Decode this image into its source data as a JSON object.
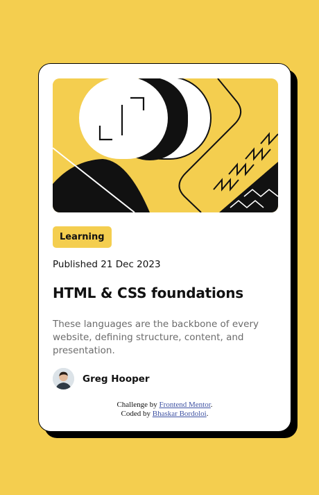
{
  "card": {
    "tag": "Learning",
    "published": "Published 21 Dec 2023",
    "title": "HTML & CSS foundations",
    "description": "These languages are the backbone of every website, defining structure, content, and presentation.",
    "author": {
      "name": "Greg Hooper"
    }
  },
  "attribution": {
    "line1_prefix": "Challenge by ",
    "line1_link": "Frontend Mentor",
    "line1_suffix": ".",
    "line2_prefix": "Coded by ",
    "line2_link": "Bhaskar Bordoloi",
    "line2_suffix": "."
  },
  "colors": {
    "background": "#F4CE4F",
    "card": "#FFFFFF",
    "text": "#111111",
    "muted": "#6B6B6B",
    "link": "#3E52A3"
  },
  "icons": {
    "hero": "abstract-illustration",
    "avatar": "author-photo"
  }
}
